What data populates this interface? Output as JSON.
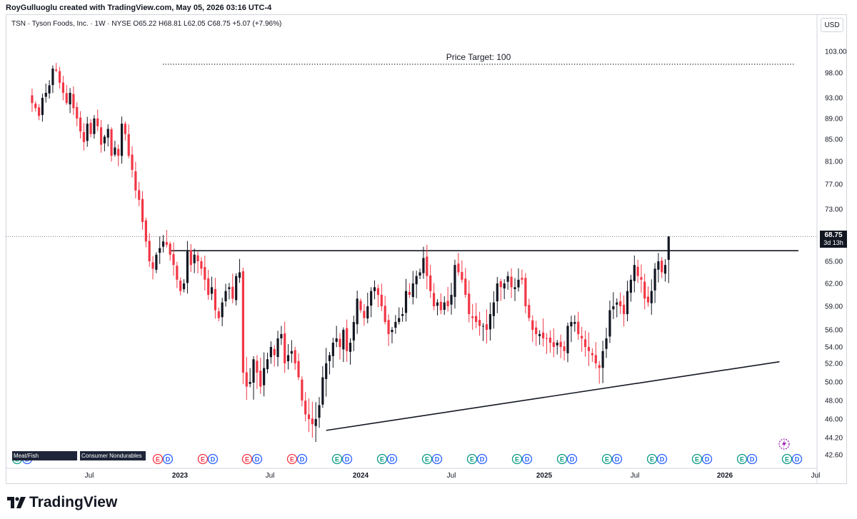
{
  "header": {
    "title": "RoyGulluoglu created with TradingView.com, May 05, 2026 03:16 UTC-4"
  },
  "symbol": {
    "text": "TSN · Tyson Foods, Inc. · 1W · NYSE  O65.22  H68.81  L62.05  C68.75  +5.07 (+7.96%)"
  },
  "currency": "USD",
  "last_price": {
    "value": "68.75",
    "countdown": "3d 13h"
  },
  "footer": {
    "brand": "TradingView"
  },
  "sector_labels": [
    "Meat/Fish",
    "Consumer Nondurables"
  ],
  "colors": {
    "up": "#131722",
    "down": "#f23645",
    "earnings": "#089981",
    "dividend": "#2962ff",
    "text": "#131722"
  },
  "chart_data": {
    "type": "candlestick",
    "title": "",
    "xlabel": "",
    "ylabel": "",
    "y_ticks": [
      "42.60",
      "44.20",
      "46.00",
      "48.00",
      "50.00",
      "52.00",
      "54.00",
      "56.00",
      "59.00",
      "62.00",
      "65.00",
      "69.00",
      "73.00",
      "77.00",
      "81.00",
      "85.00",
      "89.00",
      "93.00",
      "98.00",
      "103.00"
    ],
    "x_ticks": [
      "Jul",
      "2023",
      "Jul",
      "2024",
      "Jul",
      "2025",
      "Jul",
      "2026",
      "Jul"
    ],
    "annotations": {
      "price_target_label": "Price Target: 100"
    },
    "price_target": 100,
    "horizontal_resistance": 66.6,
    "ascending_trendline": {
      "start": {
        "date": "2023-10-23",
        "price": 44.9
      },
      "end": {
        "date": "2026-04-20",
        "price": 52.2
      }
    },
    "last_close": 68.75,
    "candles": {
      "start_date": "2022-03-07",
      "interval": "1W",
      "closes": [
        92.0,
        91.0,
        89.5,
        93.0,
        94.0,
        95.5,
        99.0,
        98.5,
        96.0,
        94.0,
        92.0,
        94.0,
        91.0,
        89.0,
        86.5,
        84.5,
        88.0,
        86.0,
        89.0,
        87.5,
        84.0,
        85.5,
        87.0,
        82.0,
        83.5,
        82.0,
        88.0,
        86.0,
        82.0,
        79.5,
        76.0,
        74.5,
        71.0,
        68.0,
        65.0,
        64.0,
        66.0,
        67.0,
        68.0,
        67.5,
        66.0,
        64.5,
        62.5,
        61.0,
        62.0,
        66.5,
        64.5,
        66.0,
        65.0,
        64.0,
        62.5,
        60.5,
        61.5,
        58.5,
        57.5,
        59.5,
        61.0,
        61.5,
        60.0,
        63.0,
        63.5,
        51.0,
        49.5,
        50.0,
        52.5,
        51.0,
        49.5,
        51.5,
        52.5,
        54.0,
        53.0,
        55.0,
        55.5,
        52.0,
        53.0,
        53.5,
        52.0,
        50.5,
        48.0,
        46.5,
        46.0,
        45.5,
        46.0,
        47.5,
        50.5,
        52.0,
        53.0,
        54.5,
        55.0,
        54.0,
        56.0,
        53.5,
        54.5,
        57.0,
        60.0,
        58.5,
        57.5,
        59.0,
        61.0,
        61.5,
        60.5,
        59.0,
        57.0,
        55.5,
        56.0,
        57.0,
        57.5,
        58.0,
        61.0,
        60.5,
        62.0,
        63.0,
        63.5,
        65.5,
        63.0,
        61.0,
        59.0,
        59.5,
        58.5,
        59.5,
        59.0,
        60.5,
        64.5,
        63.5,
        62.5,
        60.5,
        58.0,
        57.5,
        57.0,
        56.5,
        56.5,
        56.0,
        58.0,
        59.5,
        62.0,
        61.5,
        62.0,
        63.0,
        61.5,
        61.5,
        62.5,
        62.5,
        59.0,
        57.5,
        56.0,
        55.5,
        55.5,
        55.0,
        55.0,
        54.5,
        54.0,
        54.5,
        54.0,
        53.5,
        56.5,
        57.0,
        57.0,
        55.5,
        55.0,
        54.0,
        53.5,
        53.0,
        52.0,
        51.5,
        53.5,
        55.0,
        58.5,
        59.0,
        59.5,
        59.0,
        58.0,
        61.0,
        62.5,
        64.5,
        63.0,
        62.5,
        60.0,
        59.5,
        61.0,
        64.0,
        65.0,
        63.5,
        64.5,
        68.75
      ]
    }
  }
}
